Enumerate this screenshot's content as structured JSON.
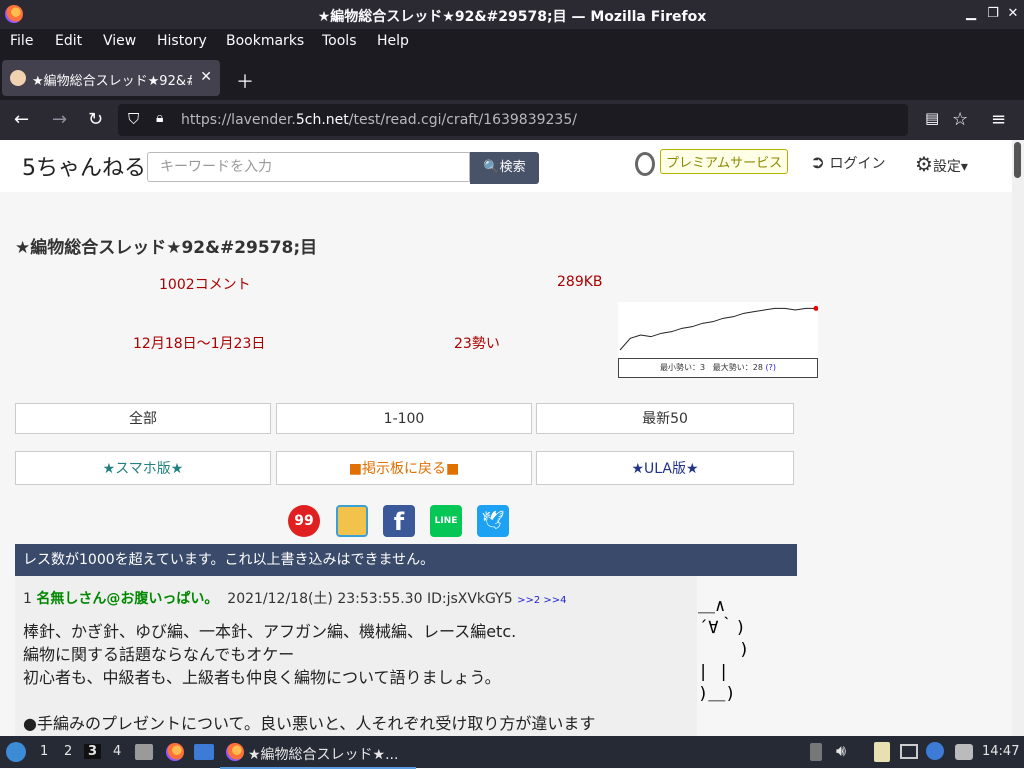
{
  "window": {
    "title": "★編物総合スレッド★92&#29578;目 — Mozilla Firefox"
  },
  "menu": [
    "File",
    "Edit",
    "View",
    "History",
    "Bookmarks",
    "Tools",
    "Help"
  ],
  "tab": {
    "title": "★編物総合スレッド★92&#"
  },
  "url": {
    "prefix": "https://lavender.",
    "domain": "5ch.net",
    "path": "/test/read.cgi/craft/1639839235/"
  },
  "site": {
    "logo": "5ちゃんねる",
    "search_placeholder": "キーワードを入力",
    "search_button": "🔍検索",
    "premium": "プレミアムサービス",
    "login": "ログイン",
    "settings": "設定▾"
  },
  "thread": {
    "title": "★編物総合スレッド★92&#29578;目",
    "comments": "1002コメント",
    "size": "289KB",
    "period": "12月18日〜1月23日",
    "momentum": "23勢い",
    "graph_min": "最小勢い：3",
    "graph_max": "最大勢い：28",
    "graph_help": "(?)"
  },
  "buttons": {
    "all": "全部",
    "range": "1-100",
    "latest": "最新50",
    "smartphone": "★スマホ版★",
    "board": "■掲示板に戻る■",
    "ula": "★ULA版★"
  },
  "notice": "レス数が1000を超えています。これ以上書き込みはできません。",
  "post": {
    "number": "1",
    "name": "名無しさん@お腹いっぱい。",
    "date": "2021/12/18(土) 23:53:55.30 ID:jsXVkGY5",
    "anchors": ">>2 >>4",
    "body": "棒針、かぎ針、ゆび編、一本針、アフガン編、機械編、レース編etc.\n編物に関する話題ならなんでもオケー\n初心者も、中級者も、上級者も仲良く編物について語りましょう。\n\n●手編みのプレゼントについて。良い悪いと、人それぞれ受け取り方が違います"
  },
  "ascii_art": "＿∧\n´∀｀)\n    )\n| |\n)＿)",
  "taskbar": {
    "workspaces": [
      "1",
      "2",
      "3",
      "4"
    ],
    "active_task": "★編物総合スレッド★...",
    "clock": "14:47"
  },
  "chart_data": {
    "type": "line",
    "series": [
      {
        "values": [
          3,
          10,
          12,
          11,
          13,
          14,
          16,
          17,
          19,
          20,
          22,
          23,
          25,
          26,
          27,
          28,
          28,
          27,
          28,
          28
        ]
      }
    ],
    "ylim": [
      0,
      30
    ]
  }
}
